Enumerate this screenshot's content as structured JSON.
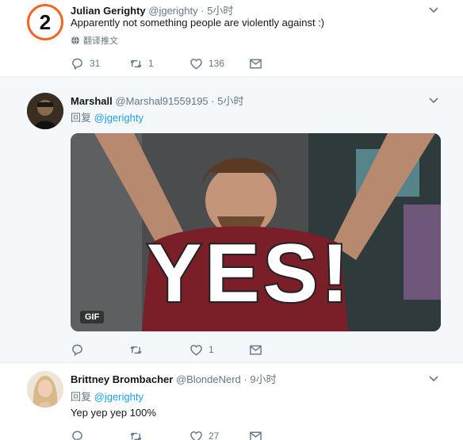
{
  "tweets": [
    {
      "name": "Julian Gerighty",
      "handle": "@jgerighty",
      "time": "5小时",
      "text": "Apparently not something people are violently against :)",
      "translate_label": "翻译推文",
      "replies": "31",
      "retweets": "1",
      "likes": "136"
    },
    {
      "name": "Marshall",
      "handle": "@Marshal91559195",
      "time": "5小时",
      "reply_prefix": "回复",
      "reply_to": "@jgerighty",
      "media_badge": "GIF",
      "media_text": "YES!",
      "replies": "",
      "retweets": "",
      "likes": "1"
    },
    {
      "name": "Brittney Brombacher",
      "handle": "@BlondeNerd",
      "time": "9小时",
      "reply_prefix": "回复",
      "reply_to": "@jgerighty",
      "text": "Yep yep yep 100%",
      "replies": "",
      "retweets": "",
      "likes": "27"
    }
  ],
  "separator": "·",
  "avatar_badge": "2",
  "colors": {
    "accent": "#1da1f2",
    "secondary_text": "#657786",
    "hover_bg": "#f5f8fa",
    "divider": "#e6ecf0"
  },
  "icons": [
    "reply-icon",
    "retweet-icon",
    "like-icon",
    "dm-icon",
    "chevron-down-icon",
    "globe-icon"
  ]
}
